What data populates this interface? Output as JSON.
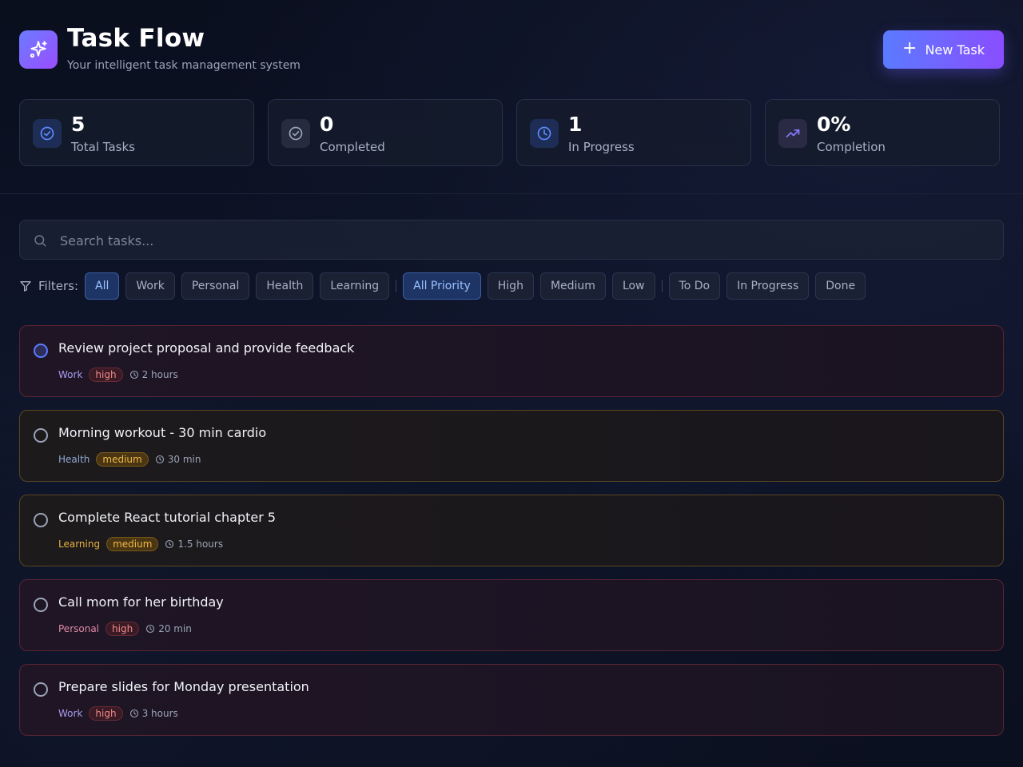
{
  "app": {
    "title": "Task Flow",
    "subtitle": "Your intelligent task management system",
    "logo_icon": "sparkles-icon",
    "new_task_label": "New Task"
  },
  "stats": [
    {
      "value": "5",
      "label": "Total Tasks",
      "icon": "check-circle-icon",
      "color": "#5b8cff"
    },
    {
      "value": "0",
      "label": "Completed",
      "icon": "check-circle-icon",
      "color": "#9aa3b8"
    },
    {
      "value": "1",
      "label": "In Progress",
      "icon": "clock-icon",
      "color": "#5b8cff"
    },
    {
      "value": "0%",
      "label": "Completion",
      "icon": "trending-up-icon",
      "color": "#8a7cff"
    }
  ],
  "search": {
    "placeholder": "Search tasks..."
  },
  "filters": {
    "label": "Filters:",
    "category": [
      "All",
      "Work",
      "Personal",
      "Health",
      "Learning"
    ],
    "priority": [
      "All Priority",
      "High",
      "Medium",
      "Low"
    ],
    "status": [
      "To Do",
      "In Progress",
      "Done"
    ],
    "active_category": "All",
    "active_priority": "All Priority"
  },
  "tasks": [
    {
      "title": "Review project proposal and provide feedback",
      "category": "Work",
      "category_color": "#a99cf0",
      "priority": "high",
      "time": "2 hours"
    },
    {
      "title": "Morning workout - 30 min cardio",
      "category": "Health",
      "category_color": "#8ea8d8",
      "priority": "medium",
      "time": "30 min"
    },
    {
      "title": "Complete React tutorial chapter 5",
      "category": "Learning",
      "category_color": "#e8b040",
      "priority": "medium",
      "time": "1.5 hours"
    },
    {
      "title": "Call mom for her birthday",
      "category": "Personal",
      "category_color": "#e08aa8",
      "priority": "high",
      "time": "20 min"
    },
    {
      "title": "Prepare slides for Monday presentation",
      "category": "Work",
      "category_color": "#a99cf0",
      "priority": "high",
      "time": "3 hours"
    }
  ]
}
